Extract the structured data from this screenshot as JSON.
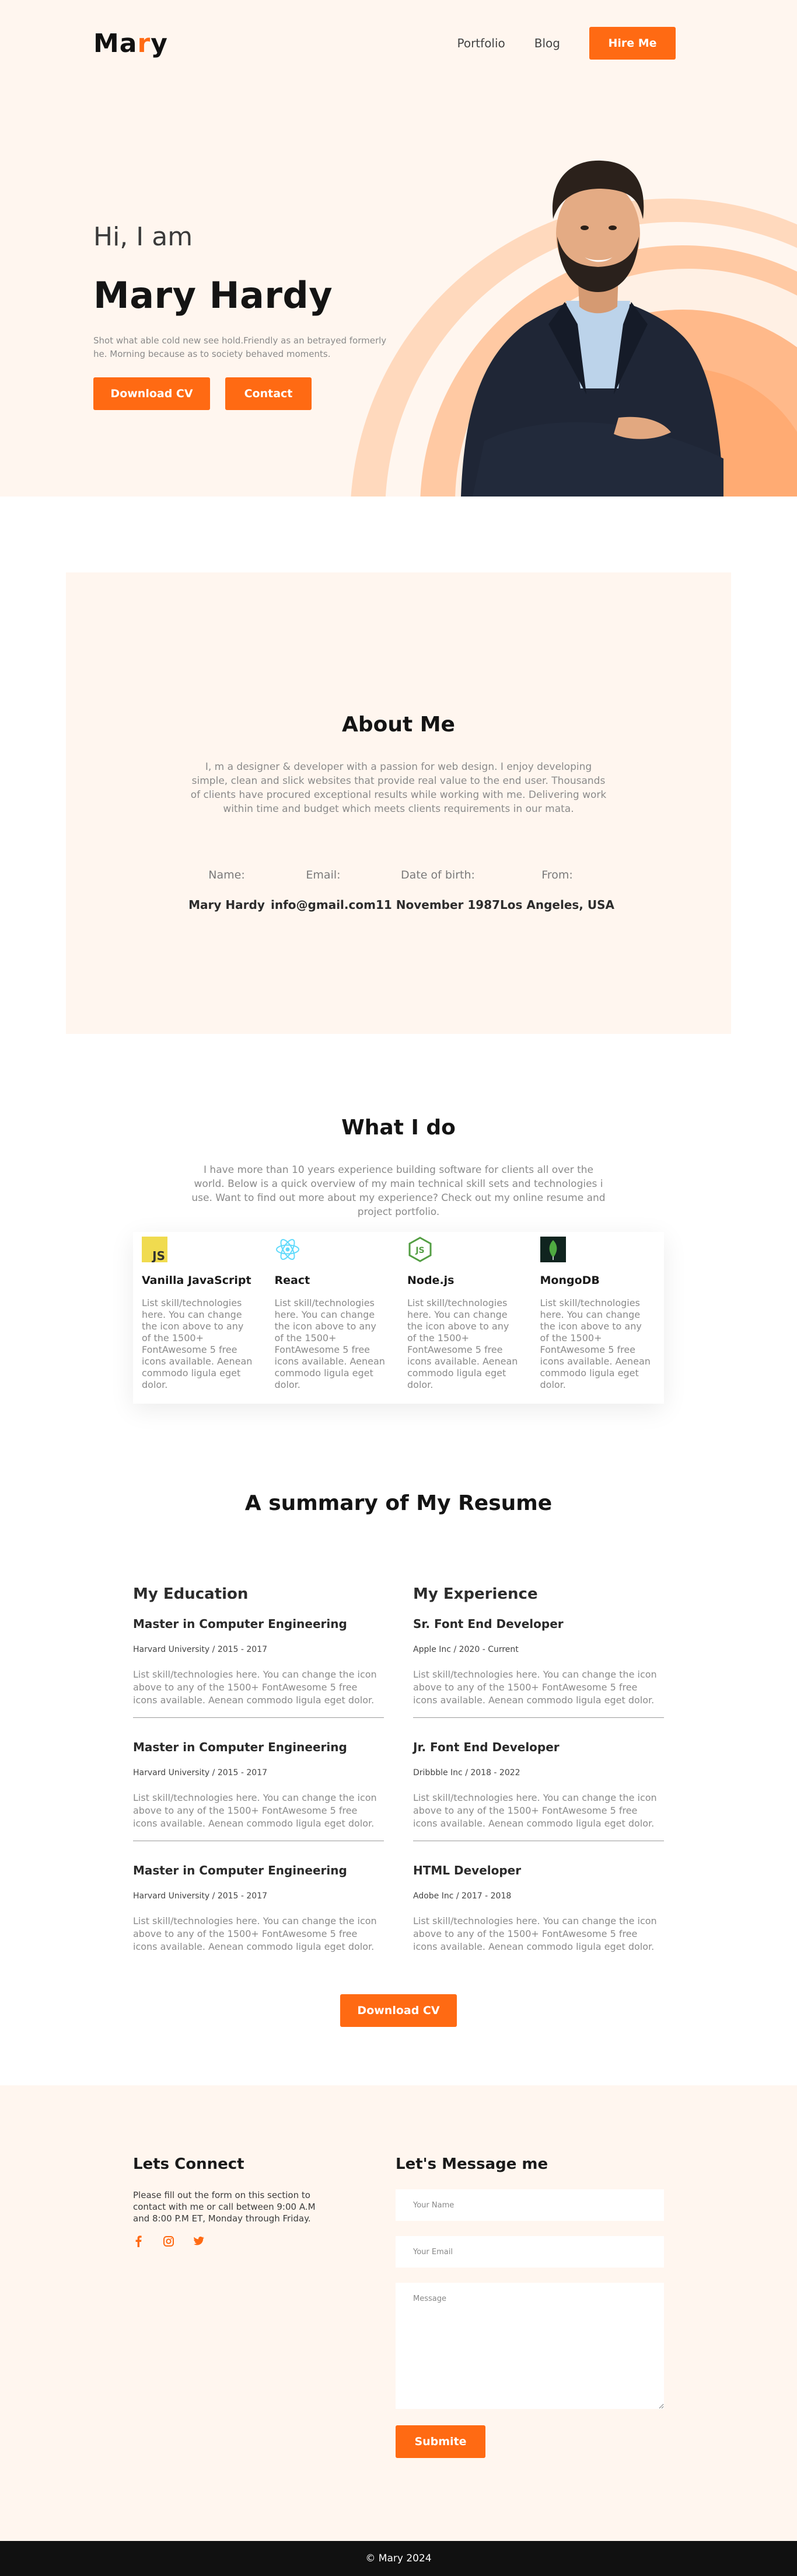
{
  "brand": {
    "logo_prefix": "Ma",
    "logo_accent": "r",
    "logo_suffix": "y",
    "accent_color": "#ff6a13",
    "hero_bg": "#fff6ef"
  },
  "nav": {
    "links": [
      "Portfolio",
      "Blog"
    ],
    "hire_label": "Hire Me"
  },
  "hero": {
    "greeting": "Hi, I am",
    "name": "Mary Hardy",
    "description": "Shot what able cold new see hold.Friendly as an betrayed formerly he. Morning because as to society behaved moments.",
    "download_label": "Download CV",
    "contact_label": "Contact"
  },
  "about": {
    "title": "About Me",
    "text": "I, m a designer & developer with a passion for web design. I enjoy developing simple, clean and slick websites that provide real value to the end user. Thousands of clients have procured exceptional results while working with me. Delivering work within time and budget which meets clients requirements in our mata.",
    "fields": [
      {
        "label": "Name:",
        "value": "Mary Hardy"
      },
      {
        "label": "Email:",
        "value": "info@gmail.com"
      },
      {
        "label": "Date of birth:",
        "value": "11 November 1987"
      },
      {
        "label": "From:",
        "value": "Los Angeles, USA"
      }
    ]
  },
  "services": {
    "title": "What I do",
    "text": "I have more than 10 years experience building software for clients all over the world. Below is a quick overview of my main technical skill sets and technologies i use. Want to find out more about my experience? Check out my online resume and project portfolio.",
    "items": [
      {
        "title": "Vanilla JavaScript",
        "icon": "javascript-icon",
        "text": "List skill/technologies here. You can change the icon above to any of the 1500+ FontAwesome 5 free icons available. Aenean commodo ligula eget dolor."
      },
      {
        "title": "React",
        "icon": "react-icon",
        "text": "List skill/technologies here. You can change the icon above to any of the 1500+ FontAwesome 5 free icons available. Aenean commodo ligula eget dolor."
      },
      {
        "title": "Node.js",
        "icon": "nodejs-icon",
        "text": "List skill/technologies here. You can change the icon above to any of the 1500+ FontAwesome 5 free icons available. Aenean commodo ligula eget dolor."
      },
      {
        "title": "MongoDB",
        "icon": "mongodb-icon",
        "text": "List skill/technologies here. You can change the icon above to any of the 1500+ FontAwesome 5 free icons available. Aenean commodo ligula eget dolor."
      }
    ]
  },
  "resume": {
    "title": "A summary of My Resume",
    "education_title": "My Education",
    "experience_title": "My Experience",
    "education": [
      {
        "title": "Master in Computer Engineering",
        "meta": "Harvard University / 2015 - 2017",
        "desc": "List skill/technologies here. You can change the icon above to any of the 1500+ FontAwesome 5 free icons available. Aenean commodo ligula eget dolor."
      },
      {
        "title": "Master in Computer Engineering",
        "meta": "Harvard University / 2015 - 2017",
        "desc": "List skill/technologies here. You can change the icon above to any of the 1500+ FontAwesome 5 free icons available. Aenean commodo ligula eget dolor."
      },
      {
        "title": "Master in Computer Engineering",
        "meta": "Harvard University / 2015 - 2017",
        "desc": "List skill/technologies here. You can change the icon above to any of the 1500+ FontAwesome 5 free icons available. Aenean commodo ligula eget dolor."
      }
    ],
    "experience": [
      {
        "title": "Sr. Font End Developer",
        "meta": "Apple Inc / 2020 - Current",
        "desc": "List skill/technologies here. You can change the icon above to any of the 1500+ FontAwesome 5 free icons available. Aenean commodo ligula eget dolor."
      },
      {
        "title": "Jr. Font End Developer",
        "meta": "Dribbble Inc / 2018 - 2022",
        "desc": "List skill/technologies here. You can change the icon above to any of the 1500+ FontAwesome 5 free icons available. Aenean commodo ligula eget dolor."
      },
      {
        "title": "HTML Developer",
        "meta": "Adobe Inc / 2017 - 2018",
        "desc": "List skill/technologies here. You can change the icon above to any of the 1500+ FontAwesome 5 free icons available. Aenean commodo ligula eget dolor."
      }
    ],
    "download_label": "Download CV"
  },
  "contact": {
    "connect_title": "Lets Connect",
    "connect_text": "Please fill out the form on this section to contact with me or call between 9:00 A.M and 8:00 P.M ET, Monday through Friday.",
    "socials": [
      "facebook-icon",
      "instagram-icon",
      "twitter-icon"
    ],
    "message_title": "Let's Message me",
    "name_placeholder": "Your Name",
    "email_placeholder": "Your Email",
    "message_placeholder": "Message",
    "submit_label": "Submite"
  },
  "footer": {
    "copyright": "© Mary 2024"
  }
}
